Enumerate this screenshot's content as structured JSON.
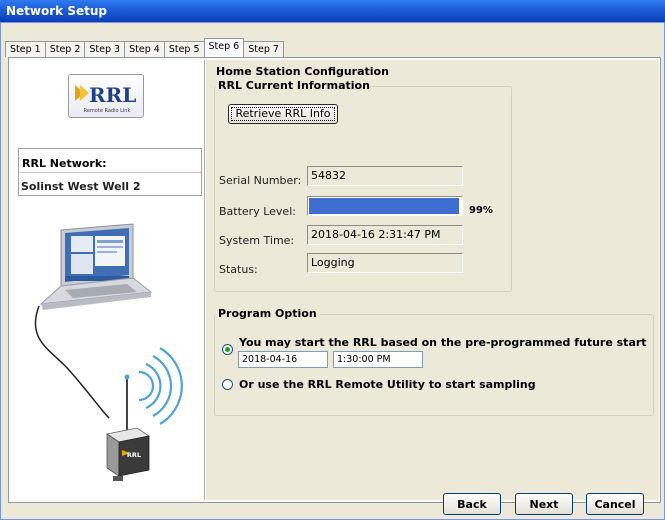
{
  "window": {
    "title": "Network Setup"
  },
  "tabs": [
    "Step 1",
    "Step 2",
    "Step 3",
    "Step 4",
    "Step 5",
    "Step 6",
    "Step 7"
  ],
  "active_tab_index": 5,
  "left_panel": {
    "logo_text": "RRL",
    "logo_subtext": "Remote Radio Link",
    "network_label": "RRL Network:",
    "network_name": "Solinst West Well 2",
    "device_label": "RRL"
  },
  "main": {
    "section_title": "Home Station Configuration",
    "current_info": {
      "group_label": "RRL Current Information",
      "retrieve_button": "Retrieve RRL Info",
      "serial_label": "Serial Number:",
      "serial_value": "54832",
      "battery_label": "Battery Level:",
      "battery_percent": 99,
      "battery_text": "99%",
      "time_label": "System Time:",
      "time_value": "2018-04-16 2:31:47 PM",
      "status_label": "Status:",
      "status_value": "Logging"
    },
    "program_option": {
      "group_label": "Program Option",
      "option1_label": "You may start the RRL based on the pre-programmed future start time",
      "option1_checked": true,
      "start_date": "2018-04-16",
      "start_time": "1:30:00 PM",
      "option2_label": "Or use the RRL Remote Utility to start sampling",
      "option2_checked": false
    }
  },
  "footer": {
    "back": "Back",
    "next": "Next",
    "cancel": "Cancel"
  },
  "colors": {
    "title_bar": "#1a5cd6",
    "battery_fill": "#3f6ed1",
    "window_bg": "#ece9d8"
  }
}
